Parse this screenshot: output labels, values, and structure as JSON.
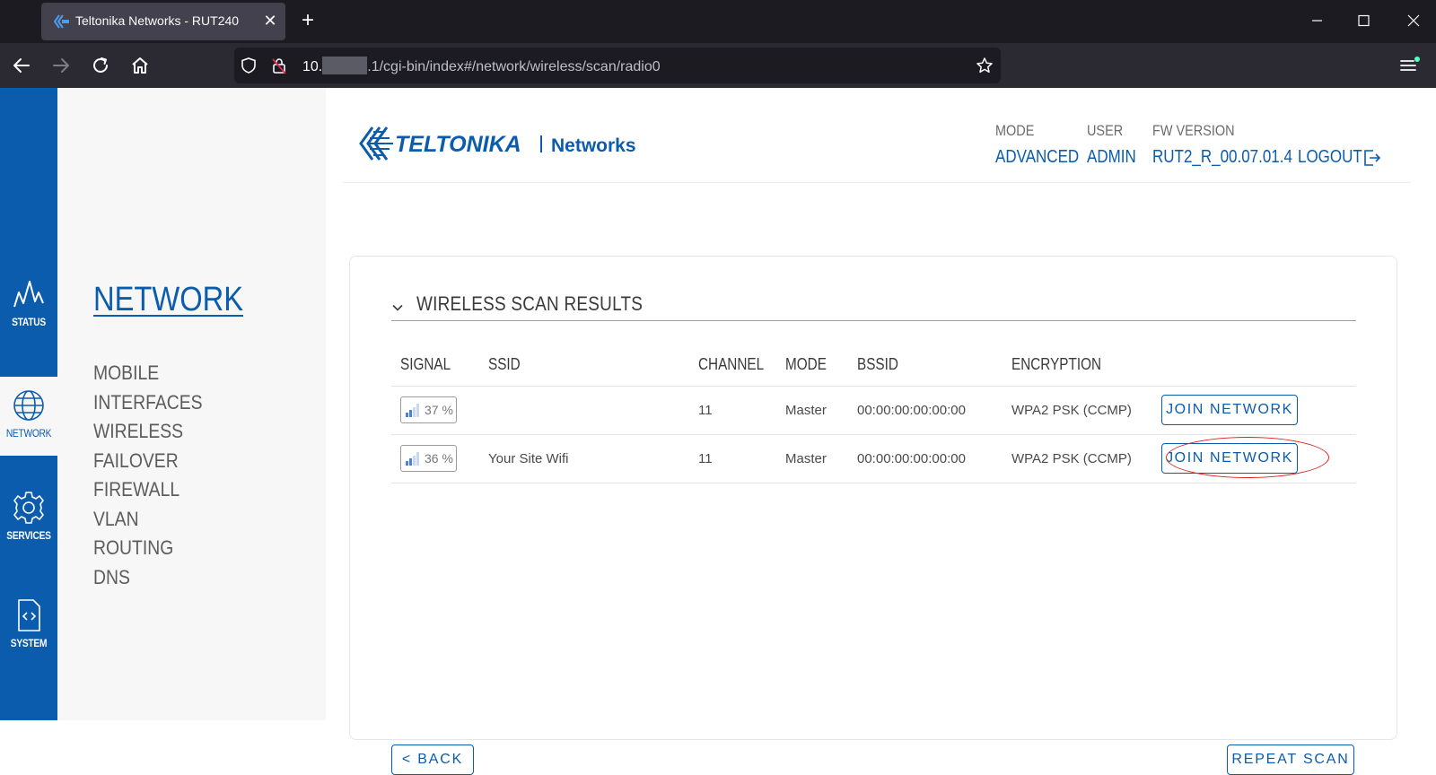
{
  "browser": {
    "tab_title": "Teltonika Networks - RUT240",
    "tab_close": "✕",
    "new_tab": "+",
    "url_prefix": "10.",
    "url_suffix": ".1/cgi-bin/index#/network/wireless/scan/radio0"
  },
  "sidebar_icons": [
    {
      "label": "STATUS",
      "icon": "activity-icon"
    },
    {
      "label": "NETWORK",
      "icon": "globe-icon"
    },
    {
      "label": "SERVICES",
      "icon": "gear-icon"
    },
    {
      "label": "SYSTEM",
      "icon": "code-file-icon"
    }
  ],
  "submenu": {
    "title": "NETWORK",
    "items": [
      "MOBILE",
      "INTERFACES",
      "WIRELESS",
      "FAILOVER",
      "FIREWALL",
      "VLAN",
      "ROUTING",
      "DNS"
    ]
  },
  "header": {
    "logo_brand": "TELTONIKA",
    "logo_sub": "Networks",
    "mode_label": "MODE",
    "mode_value": "ADVANCED",
    "user_label": "USER",
    "user_value": "ADMIN",
    "fw_label": "FW VERSION",
    "fw_value": "RUT2_R_00.07.01.4",
    "logout": "LOGOUT"
  },
  "scan": {
    "title": "WIRELESS SCAN RESULTS",
    "columns": [
      "SIGNAL",
      "SSID",
      "CHANNEL",
      "MODE",
      "BSSID",
      "ENCRYPTION"
    ],
    "rows": [
      {
        "signal": "37 %",
        "ssid": "",
        "channel": "11",
        "mode": "Master",
        "bssid": "00:00:00:00:00:00",
        "encryption": "WPA2 PSK (CCMP)",
        "action": "JOIN NETWORK"
      },
      {
        "signal": "36 %",
        "ssid": "Your Site Wifi",
        "channel": "11",
        "mode": "Master",
        "bssid": "00:00:00:00:00:00",
        "encryption": "WPA2 PSK (CCMP)",
        "action": "JOIN NETWORK"
      }
    ],
    "back": "< BACK",
    "repeat": "REPEAT SCAN"
  },
  "colors": {
    "brand_blue": "#0b5cad",
    "highlight_red": "#e02020"
  }
}
